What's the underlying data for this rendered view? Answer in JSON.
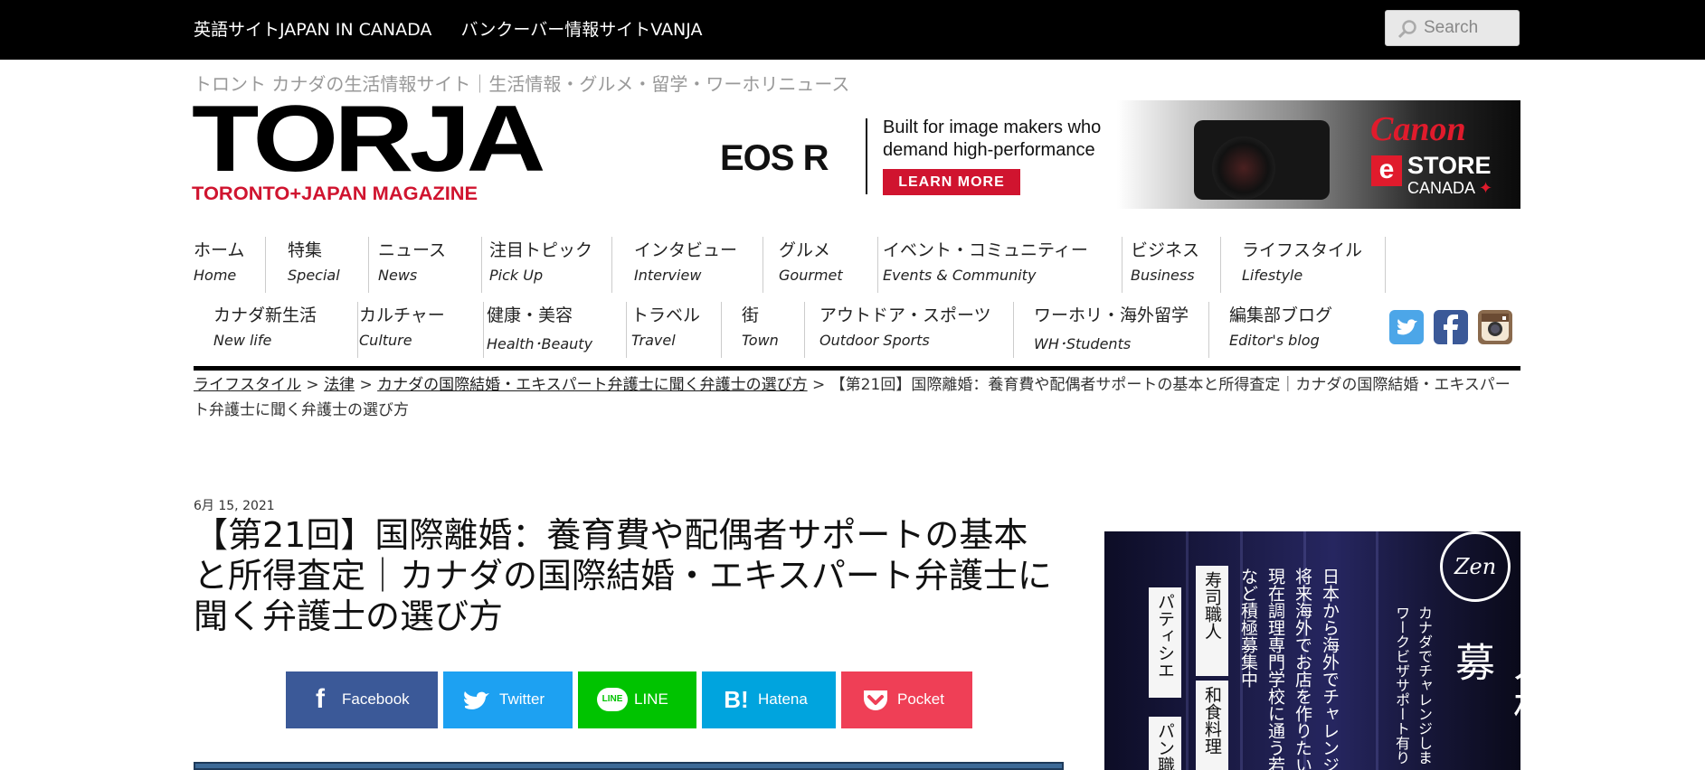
{
  "topbar": {
    "links": [
      "英語サイトJAPAN IN CANADA",
      "バンクーバー情報サイトVANJA"
    ],
    "search_placeholder": "Search"
  },
  "header": {
    "tagline": "トロント カナダの生活情報サイト｜生活情報・グルメ・留学・ワーホリニュース",
    "logo_main": "TORJA",
    "logo_sub": "TORONTO+JAPAN MAGAZINE"
  },
  "banner": {
    "product": "EOS R",
    "tagline": "Built for image makers who demand high-performance",
    "cta": "LEARN MORE",
    "brand": "Canon",
    "store_e": "e",
    "store": "STORE",
    "store_country": "CANADA"
  },
  "nav": {
    "row1": [
      {
        "ja": "ホーム",
        "en": "Home"
      },
      {
        "ja": "特集",
        "en": "Special"
      },
      {
        "ja": "ニュース",
        "en": "News"
      },
      {
        "ja": "注目トピック",
        "en": "Pick Up"
      },
      {
        "ja": "インタビュー",
        "en": "Interview"
      },
      {
        "ja": "グルメ",
        "en": "Gourmet"
      },
      {
        "ja": "イベント・コミュニティー",
        "en": "Events & Community"
      },
      {
        "ja": "ビジネス",
        "en": "Business"
      },
      {
        "ja": "ライフスタイル",
        "en": "Lifestyle"
      }
    ],
    "row2": [
      {
        "ja": "カナダ新生活",
        "en": "New life"
      },
      {
        "ja": "カルチャー",
        "en": "Culture"
      },
      {
        "ja": "健康・美容",
        "en": "Health･Beauty"
      },
      {
        "ja": "トラベル",
        "en": "Travel"
      },
      {
        "ja": "街",
        "en": "Town"
      },
      {
        "ja": "アウトドア・スポーツ",
        "en": "Outdoor Sports"
      },
      {
        "ja": "ワーホリ・海外留学",
        "en": "WH･Students"
      },
      {
        "ja": "編集部ブログ",
        "en": "Editor's blog"
      }
    ],
    "social": [
      "twitter-icon",
      "facebook-icon",
      "instagram-icon"
    ]
  },
  "breadcrumb": {
    "links": [
      "ライフスタイル",
      "法律",
      "カナダの国際結婚・エキスパート弁護士に聞く弁護士の選び方"
    ],
    "separator": " > ",
    "current": "【第21回】国際離婚：養育費や配偶者サポートの基本と所得査定｜カナダの国際結婚・エキスパート弁護士に聞く弁護士の選び方"
  },
  "article": {
    "date": "6月 15, 2021",
    "title": "【第21回】国際離婚：養育費や配偶者サポートの基本と所得査定｜カナダの国際結婚・エキスパート弁護士に聞く弁護士の選び方"
  },
  "share": [
    {
      "label": "Facebook",
      "icon": "f",
      "color": "#3b5998"
    },
    {
      "label": "Twitter",
      "icon": "t",
      "color": "#1da1f2"
    },
    {
      "label": "LINE",
      "icon": "LINE",
      "color": "#00c300"
    },
    {
      "label": "Hatena",
      "icon": "B!",
      "color": "#00a4de"
    },
    {
      "label": "Pocket",
      "icon": "p",
      "color": "#ef3f56"
    }
  ],
  "sidebar_ad": {
    "logo": "Zen",
    "cards": [
      "パティシエ",
      "寿司職人",
      "和食料理",
      "パン職"
    ],
    "checklist": [
      "日本から海外でチャレンジ",
      "将来海外でお店を作りたい",
      "現在調理専門学校に通う若"
    ],
    "note": "など積極募集中",
    "headline_small": "カナダでチャレンジしま",
    "headline_small2": "ワークビザサポート有り",
    "headline": "人材募"
  }
}
